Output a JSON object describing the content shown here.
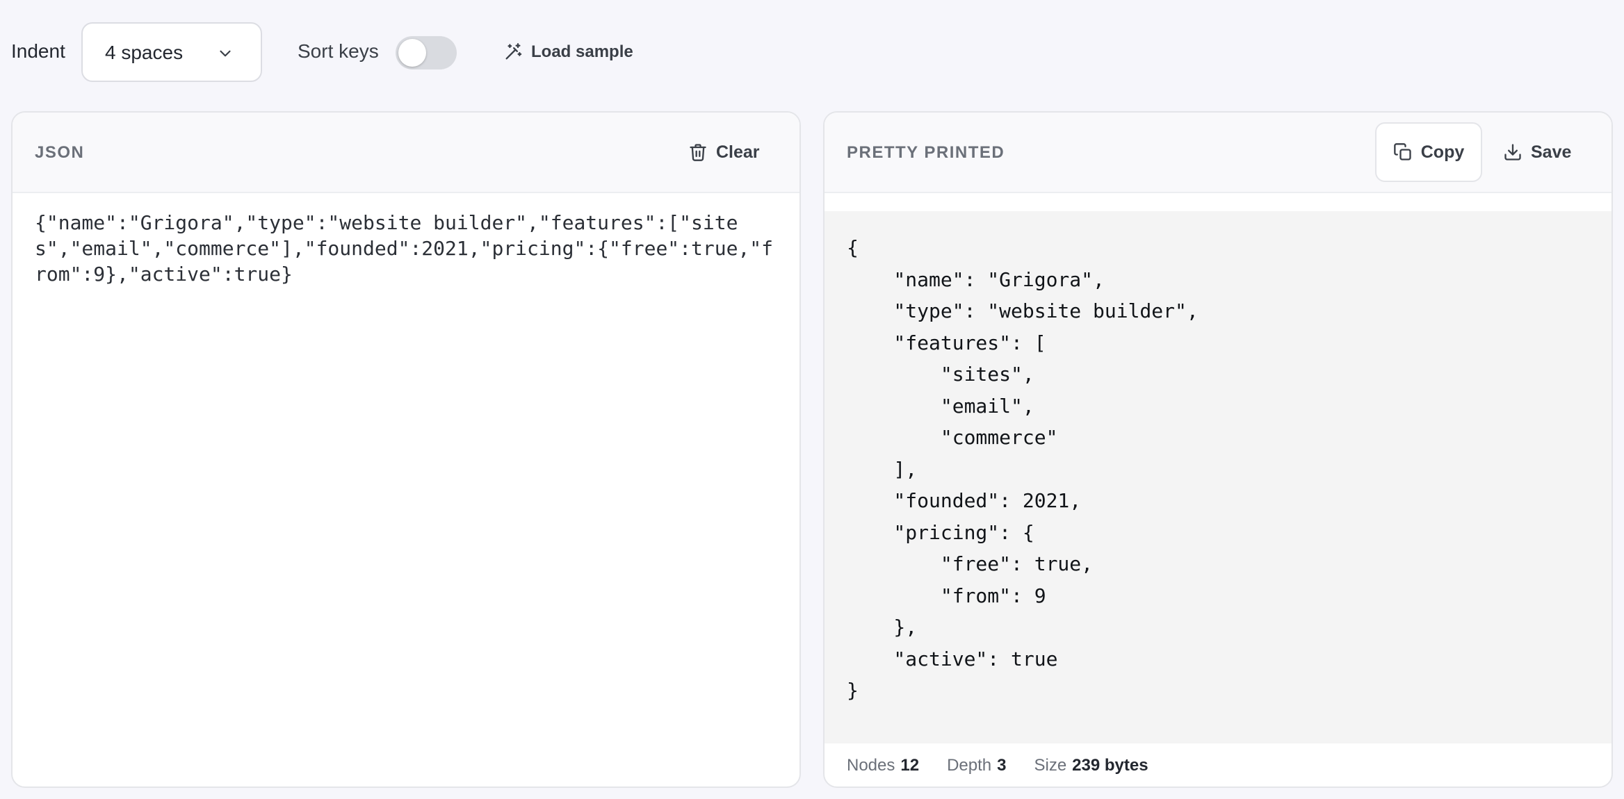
{
  "toolbar": {
    "indent_label": "Indent",
    "indent_value": "4 spaces",
    "sort_keys_label": "Sort keys",
    "sort_keys_enabled": false,
    "load_sample_label": "Load sample"
  },
  "input_panel": {
    "title": "JSON",
    "clear_label": "Clear",
    "content": "{\"name\":\"Grigora\",\"type\":\"website builder\",\"features\":[\"sites\",\"email\",\"commerce\"],\"founded\":2021,\"pricing\":{\"free\":true,\"from\":9},\"active\":true}"
  },
  "output_panel": {
    "title": "PRETTY PRINTED",
    "copy_label": "Copy",
    "save_label": "Save",
    "content": "{\n    \"name\": \"Grigora\",\n    \"type\": \"website builder\",\n    \"features\": [\n        \"sites\",\n        \"email\",\n        \"commerce\"\n    ],\n    \"founded\": 2021,\n    \"pricing\": {\n        \"free\": true,\n        \"from\": 9\n    },\n    \"active\": true\n}",
    "stats": {
      "nodes_label": "Nodes",
      "nodes_value": "12",
      "depth_label": "Depth",
      "depth_value": "3",
      "size_label": "Size",
      "size_value": "239 bytes"
    }
  },
  "icons": {
    "chevron": "chevron-down-icon",
    "load_sample": "magic-wand-icon",
    "clear": "trash-icon",
    "copy": "copy-icon",
    "save": "download-icon"
  }
}
